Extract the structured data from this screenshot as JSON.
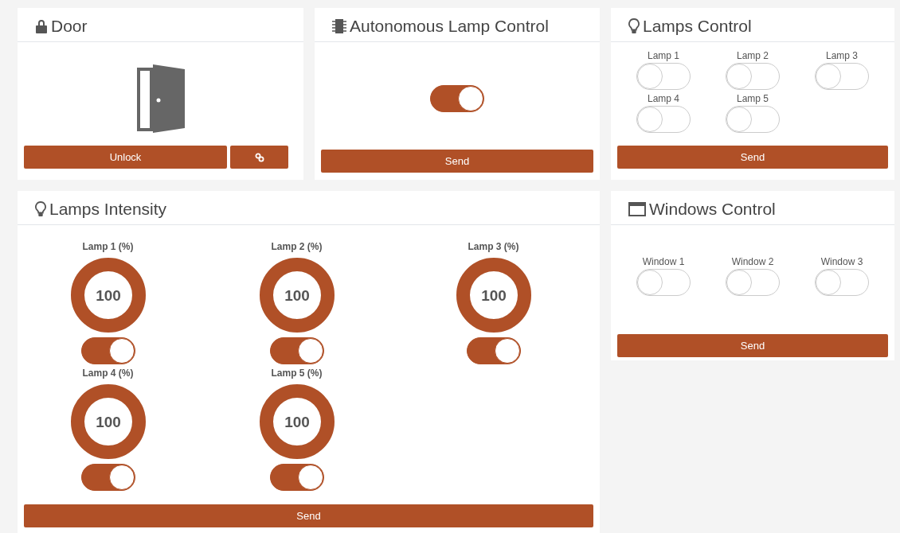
{
  "door": {
    "title": "Door",
    "unlock_label": "Unlock"
  },
  "autonomous": {
    "title": "Autonomous Lamp Control",
    "on": true,
    "send_label": "Send"
  },
  "lamps_control": {
    "title": "Lamps Control",
    "switches": [
      {
        "label": "Lamp 1",
        "on": false
      },
      {
        "label": "Lamp 2",
        "on": false
      },
      {
        "label": "Lamp 3",
        "on": false
      },
      {
        "label": "Lamp 4",
        "on": false
      },
      {
        "label": "Lamp 5",
        "on": false
      }
    ],
    "send_label": "Send"
  },
  "lamps_intensity": {
    "title": "Lamps Intensity",
    "lamps": [
      {
        "label": "Lamp 1 (%)",
        "value": "100",
        "level": 1,
        "on": true
      },
      {
        "label": "Lamp 2 (%)",
        "value": "100",
        "level": 1,
        "on": true
      },
      {
        "label": "Lamp 3 (%)",
        "value": "100",
        "level": 1,
        "on": true
      },
      {
        "label": "Lamp 4 (%)",
        "value": "100",
        "level": 1,
        "on": true
      },
      {
        "label": "Lamp 5 (%)",
        "value": "100",
        "level": 1,
        "on": true
      }
    ],
    "send_label": "Send"
  },
  "windows_control": {
    "title": "Windows Control",
    "switches": [
      {
        "label": "Window 1",
        "on": false
      },
      {
        "label": "Window 2",
        "on": false
      },
      {
        "label": "Window 3",
        "on": false
      }
    ],
    "send_label": "Send"
  }
}
